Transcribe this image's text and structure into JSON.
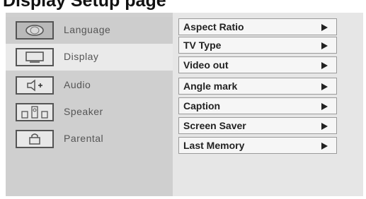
{
  "title": "Display Setup page",
  "nav": [
    {
      "label": "Language",
      "icon": "globe-icon"
    },
    {
      "label": "Display",
      "icon": "monitor-icon"
    },
    {
      "label": "Audio",
      "icon": "speaker-sound-icon"
    },
    {
      "label": "Speaker",
      "icon": "speaker-array-icon"
    },
    {
      "label": "Parental",
      "icon": "lock-icon"
    }
  ],
  "options": [
    {
      "label": "Aspect Ratio"
    },
    {
      "label": "TV Type"
    },
    {
      "label": "Video out"
    },
    {
      "label": "Angle mark"
    },
    {
      "label": "Caption"
    },
    {
      "label": "Screen Saver"
    },
    {
      "label": "Last Memory"
    }
  ]
}
